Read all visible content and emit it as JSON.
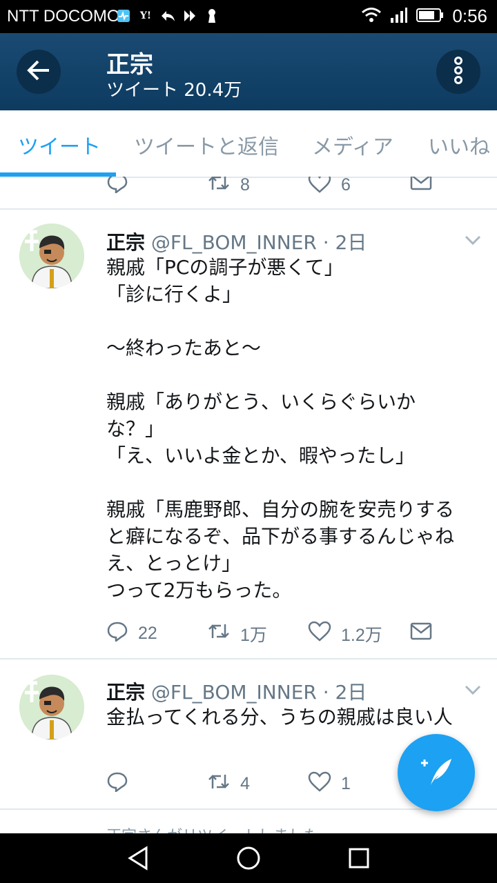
{
  "status_bar": {
    "carrier": "NTT DOCOMO",
    "time": "0:56"
  },
  "app_bar": {
    "title": "正宗",
    "subtitle": "ツイート 20.4万"
  },
  "tabs": [
    {
      "label": "ツイート",
      "active": true
    },
    {
      "label": "ツイートと返信",
      "active": false
    },
    {
      "label": "メディア",
      "active": false
    },
    {
      "label": "いいね",
      "active": false
    }
  ],
  "previous_tweet": {
    "retweets": "8",
    "likes": "6"
  },
  "tweets": [
    {
      "name": "正宗",
      "handle": "@FL_BOM_INNER · 2日",
      "lines": [
        "親戚「PCの調子が悪くて」",
        "「診に行くよ」",
        "",
        "〜終わったあと〜",
        "",
        "親戚「ありがとう、いくらぐらいか",
        "な？」",
        "「え、いいよ金とか、暇やったし」",
        "",
        "親戚「馬鹿野郎、自分の腕を安売りする",
        "と癖になるぞ、品下がる事するんじゃね",
        "え、とっとけ」",
        "つって2万もらった。"
      ],
      "replies": "22",
      "retweets": "1万",
      "likes": "1.2万"
    },
    {
      "name": "正宗",
      "handle": "@FL_BOM_INNER · 2日",
      "lines": [
        "金払ってくれる分、うちの親戚は良い人"
      ],
      "replies": "",
      "retweets": "4",
      "likes": "1"
    }
  ],
  "retweet_hint": "正宗さんがリツイートしました",
  "colors": {
    "accent": "#1da1f2",
    "app_bar": "#0d3b60",
    "meta": "#657786"
  }
}
